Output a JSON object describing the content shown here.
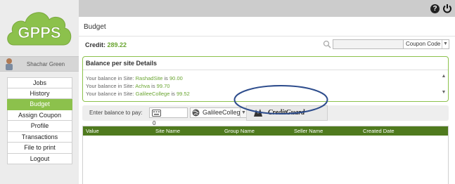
{
  "app": {
    "logo_text": "GPPS"
  },
  "user": {
    "name": "Shachar Green"
  },
  "menu": {
    "items": [
      "Jobs",
      "History",
      "Budget",
      "Assign Coupon",
      "Profile",
      "Transactions",
      "File to print",
      "Logout"
    ],
    "active": "Budget"
  },
  "topbar": {
    "help_label": "?",
    "power_icon": "power-icon"
  },
  "page": {
    "title": "Budget"
  },
  "credit": {
    "label": "Credit:",
    "value": "289.22"
  },
  "search": {
    "placeholder": "",
    "filter_value": "Coupon Code"
  },
  "balance": {
    "title": "Balance per site Details",
    "lines": [
      {
        "prefix": "Your balance in Site:",
        "site": "RashadSite",
        "mid": "is",
        "amount": "90.00"
      },
      {
        "prefix": "Your balance in Site:",
        "site": "Achva",
        "mid": "is",
        "amount": "99.70"
      },
      {
        "prefix": "Your balance in Site:",
        "site": "GalileeCollege",
        "mid": "is",
        "amount": "99.52"
      }
    ]
  },
  "payment": {
    "label": "Enter balance to pay:",
    "amount_value": "0",
    "site_value": "GalileeColleg",
    "provider_label": "CreditGuard"
  },
  "table": {
    "columns": [
      "Value",
      "Site Name",
      "Group Name",
      "Seller Name",
      "Created Date"
    ],
    "rows": []
  },
  "colors": {
    "accent": "#8cc14c",
    "table_header": "#4f7a1e",
    "highlight_ellipse": "#2d4c8c"
  }
}
